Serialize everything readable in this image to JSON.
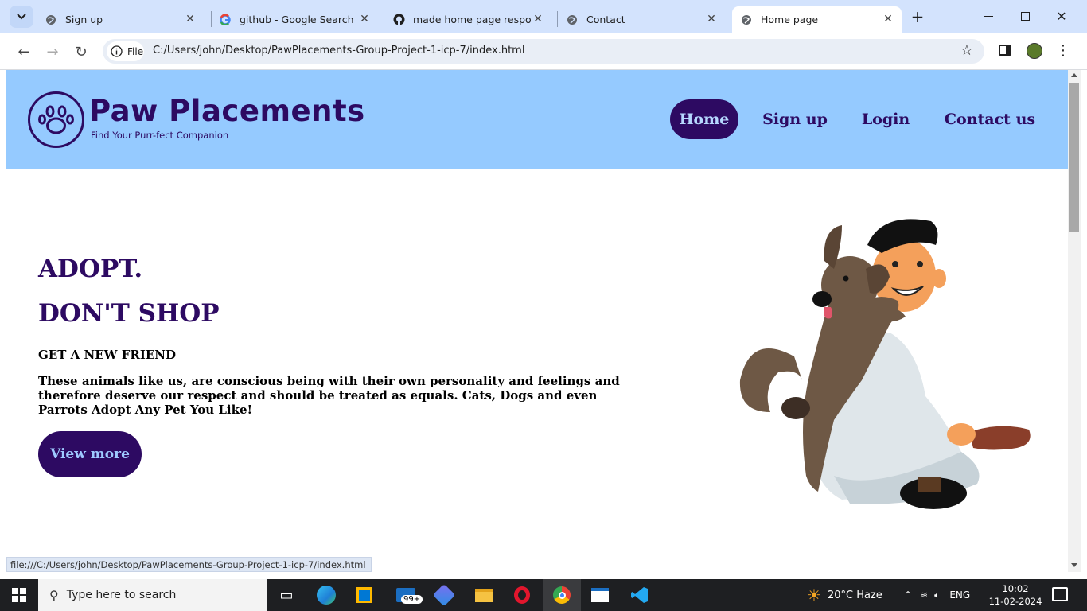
{
  "browser": {
    "tabs": [
      {
        "label": "Sign up",
        "active": false
      },
      {
        "label": "github - Google Search",
        "active": false
      },
      {
        "label": "made home page responsiv",
        "active": false
      },
      {
        "label": "Contact",
        "active": false
      },
      {
        "label": "Home page",
        "active": true
      }
    ],
    "file_chip": "File",
    "url": "C:/Users/john/Desktop/PawPlacements-Group-Project-1-icp-7/index.html",
    "status_url": "file:///C:/Users/john/Desktop/PawPlacements-Group-Project-1-icp-7/index.html"
  },
  "site": {
    "brand": "Paw Placements",
    "tagline": "Find Your Purr-fect Companion",
    "nav": [
      {
        "label": "Home",
        "active": true
      },
      {
        "label": "Sign up",
        "active": false
      },
      {
        "label": "Login",
        "active": false
      },
      {
        "label": "Contact us",
        "active": false
      }
    ],
    "hero": {
      "line1": "ADOPT.",
      "line2": "DON'T SHOP",
      "subheading": "GET A NEW FRIEND",
      "description": "These animals like us, are conscious being with their own personality and feelings and therefore deserve our respect and should be treated as equals. Cats, Dogs and even Parrots Adopt Any Pet You Like!",
      "button": "View more"
    },
    "colors": {
      "header_bg": "#95caff",
      "primary": "#2d0a62",
      "button_text": "#9ec9ff"
    }
  },
  "taskbar": {
    "search_placeholder": "Type here to search",
    "mail_badge": "99+",
    "weather": "20°C  Haze",
    "language": "ENG",
    "time": "10:02",
    "date": "11-02-2024"
  }
}
